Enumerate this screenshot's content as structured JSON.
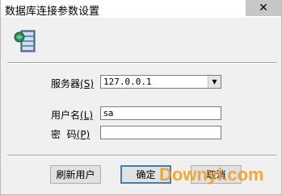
{
  "window": {
    "title": "数据库连接参数设置",
    "close_glyph": "✕"
  },
  "icons": {
    "app": "database-icon",
    "close": "close-icon",
    "dropdown": "chevron-down-icon"
  },
  "form": {
    "server_label": "服务器",
    "server_hotkey": "(S)",
    "server_value": "127.0.0.1",
    "username_label": "用户名",
    "username_hotkey": "(L)",
    "username_value": "sa",
    "password_label": "密  码",
    "password_hotkey": "(P)",
    "password_value": ""
  },
  "buttons": {
    "refresh": "刷新用户",
    "ok": "确定",
    "cancel": "取消"
  },
  "watermark": "Downyi.com",
  "colors": {
    "titlebar_bg": "#ffffff",
    "close_bg": "#c7c7c7",
    "dialog_bg": "#f0f0f0",
    "watermark": "#f39c12"
  }
}
